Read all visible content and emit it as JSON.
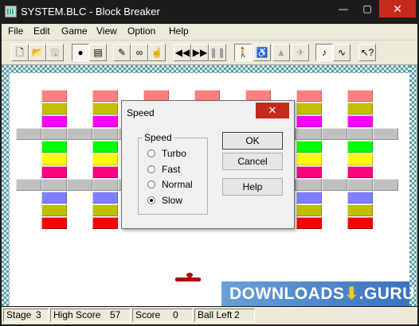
{
  "window": {
    "title": "SYSTEM.BLC - Block Breaker",
    "minimize": "—",
    "maximize": "▢",
    "close": "✕"
  },
  "menu": [
    "File",
    "Edit",
    "Game",
    "View",
    "Option",
    "Help"
  ],
  "toolbar": {
    "icons": [
      "new-file-icon",
      "open-folder-icon",
      "save-icon",
      "ball-icon",
      "board-icon",
      "brush-icon",
      "binoculars-icon",
      "hand-icon",
      "rewind-icon",
      "fast-forward-icon",
      "pause-icon",
      "walking-man-icon",
      "bicycle-icon",
      "car-icon",
      "airplane-icon",
      "music-note-icon",
      "sound-wave-icon",
      "help-pointer-icon"
    ]
  },
  "game": {
    "brick_colors": [
      "#ff7f7f",
      "#c0c000",
      "#ff00ff",
      "#c0c0c0",
      "#00ff00",
      "#ffff00",
      "#ff0080",
      "#c0c0c0",
      "#8080ff",
      "#c0c000",
      "#ff0000"
    ]
  },
  "dialog": {
    "title": "Speed",
    "close": "✕",
    "group_label": "Speed",
    "options": [
      "Turbo",
      "Fast",
      "Normal",
      "Slow"
    ],
    "selected": "Slow",
    "buttons": {
      "ok": "OK",
      "cancel": "Cancel",
      "help": "Help"
    }
  },
  "statusbar": {
    "stage_label": "Stage",
    "stage_value": "3",
    "high_score_label": "High Score",
    "high_score_value": "57",
    "score_label": "Score",
    "score_value": "0",
    "ball_left_label": "Ball Left",
    "ball_left_value": "2"
  },
  "watermark": {
    "text": "DOWNLOADS",
    "mark": "⬇",
    "suffix": ".GURU"
  },
  "colors": {
    "titlebar": "#1c1c1c",
    "close_red": "#c42b1c",
    "wall": "#5f9ea0",
    "paddle": "#b00000"
  }
}
